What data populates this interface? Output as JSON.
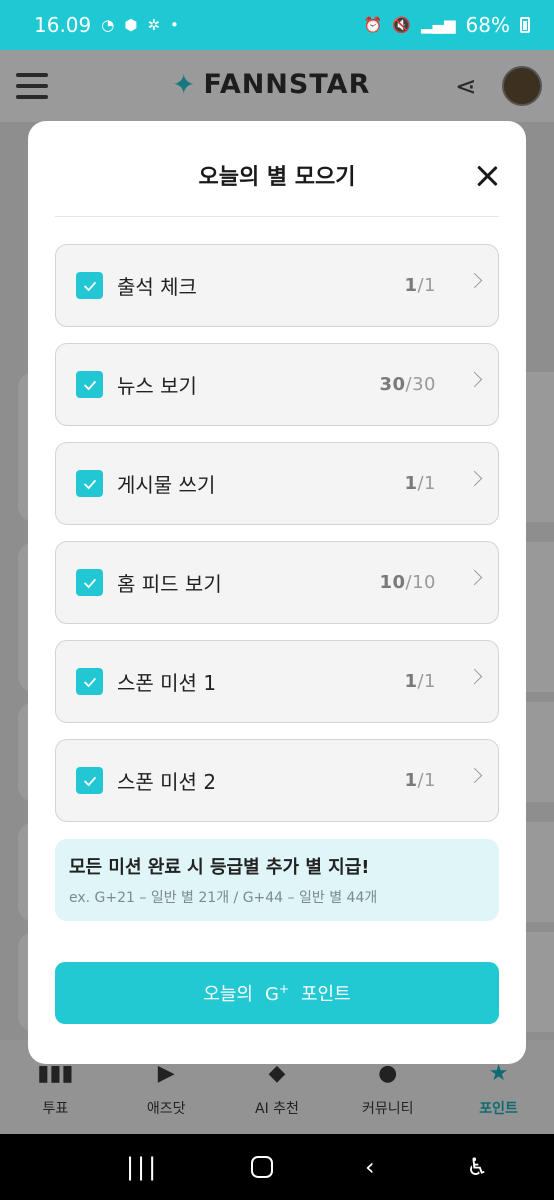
{
  "status_bar": {
    "time": "16.09",
    "battery": "68%",
    "left_icons": [
      "notification-icon",
      "app-icon",
      "sync-icon"
    ],
    "right_icons": [
      "alarm-icon",
      "mute-icon",
      "volte-icon",
      "5g-icon",
      "signal-icon",
      "battery-icon"
    ]
  },
  "header": {
    "brand": "FANNSTAR"
  },
  "modal": {
    "title": "오늘의 별 모으기",
    "missions": [
      {
        "label": "출석 체크",
        "done": "1",
        "total": "/1"
      },
      {
        "label": "뉴스 보기",
        "done": "30",
        "total": "/30"
      },
      {
        "label": "게시물 쓰기",
        "done": "1",
        "total": "/1"
      },
      {
        "label": "홈 피드 보기",
        "done": "10",
        "total": "/10"
      },
      {
        "label": "스폰 미션 1",
        "done": "1",
        "total": "/1"
      },
      {
        "label": "스폰 미션 2",
        "done": "1",
        "total": "/1"
      }
    ],
    "notice_title": "모든 미션 완료 시 등급별 추가 별 지급!",
    "notice_sub": "ex. G+21 – 일반 별 21개 / G+44 – 일반 별 44개",
    "cta_prefix": "오늘의",
    "cta_g": "G",
    "cta_plus": "+",
    "cta_suffix": "포인트"
  },
  "bottom_nav": [
    {
      "label": "투표",
      "icon": "bar-chart-icon"
    },
    {
      "label": "애즈닷",
      "icon": "play-icon"
    },
    {
      "label": "AI 추천",
      "icon": "ai-gem-icon"
    },
    {
      "label": "커뮤니티",
      "icon": "chat-icon"
    },
    {
      "label": "포인트",
      "icon": "star-icon"
    }
  ],
  "colors": {
    "accent": "#22c9d3",
    "notice_bg": "#dff5f7",
    "status_bar": "#1ec9d3"
  }
}
